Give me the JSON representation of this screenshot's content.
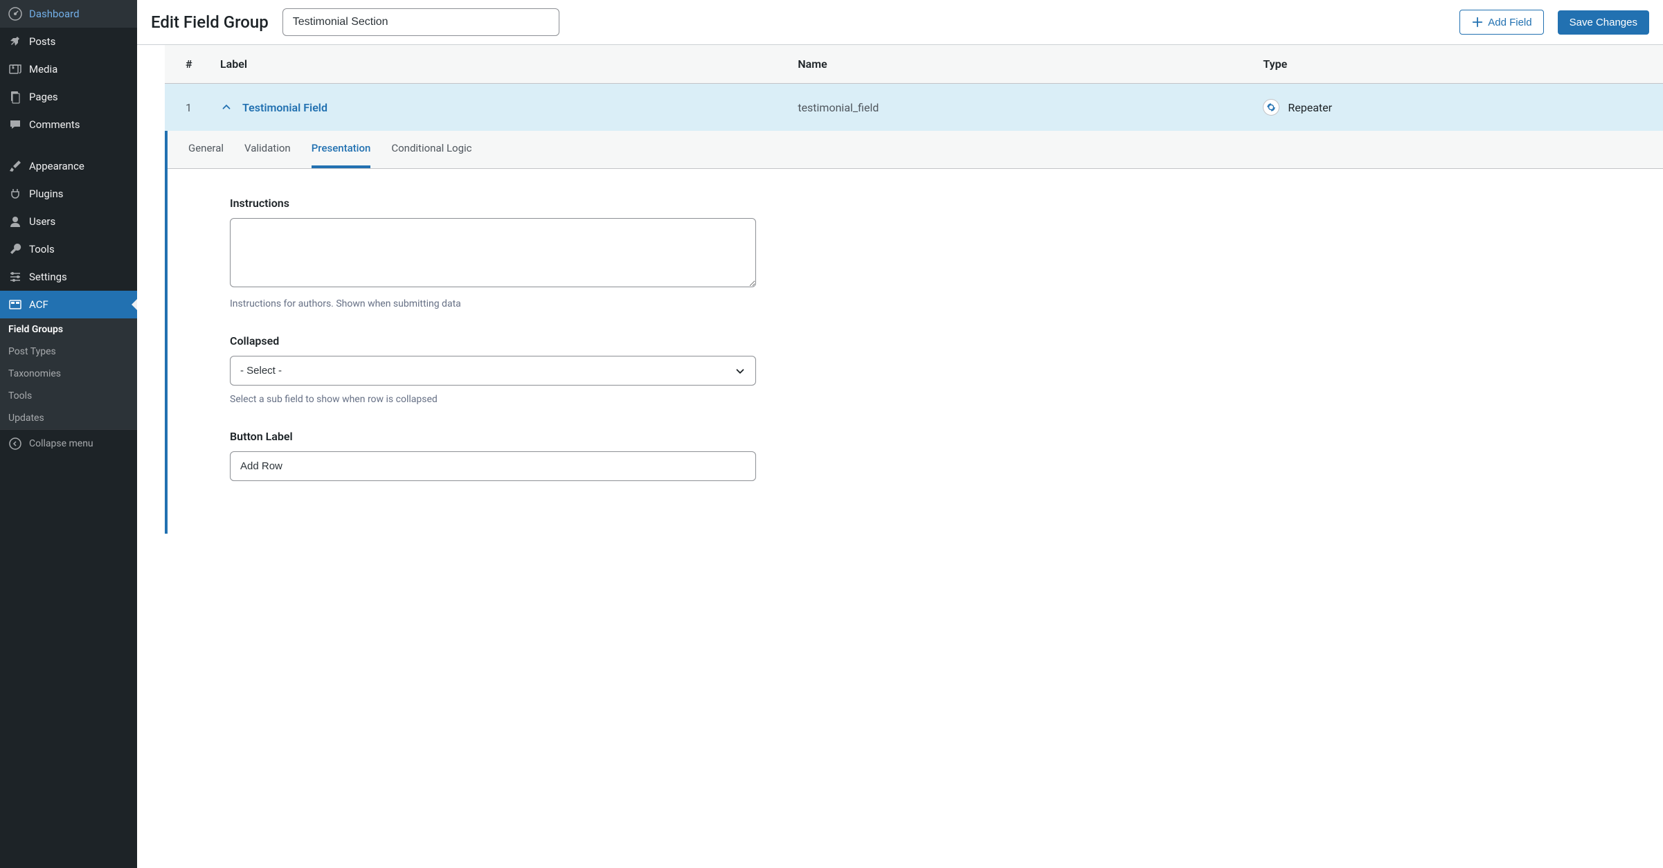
{
  "sidebar": {
    "items": [
      {
        "label": "Dashboard",
        "icon": "dashboard"
      },
      {
        "label": "Posts",
        "icon": "pin"
      },
      {
        "label": "Media",
        "icon": "media"
      },
      {
        "label": "Pages",
        "icon": "page"
      },
      {
        "label": "Comments",
        "icon": "comment"
      },
      {
        "label": "Appearance",
        "icon": "brush"
      },
      {
        "label": "Plugins",
        "icon": "plug"
      },
      {
        "label": "Users",
        "icon": "user"
      },
      {
        "label": "Tools",
        "icon": "wrench"
      },
      {
        "label": "Settings",
        "icon": "sliders"
      },
      {
        "label": "ACF",
        "icon": "acf",
        "active": true
      }
    ],
    "submenu": [
      {
        "label": "Field Groups",
        "active": true
      },
      {
        "label": "Post Types"
      },
      {
        "label": "Taxonomies"
      },
      {
        "label": "Tools"
      },
      {
        "label": "Updates"
      }
    ],
    "collapse_label": "Collapse menu"
  },
  "header": {
    "title": "Edit Field Group",
    "group_name": "Testimonial Section",
    "add_field_label": "Add Field",
    "save_label": "Save Changes"
  },
  "table": {
    "columns": {
      "num": "#",
      "label": "Label",
      "name": "Name",
      "type": "Type"
    },
    "rows": [
      {
        "num": "1",
        "label": "Testimonial Field",
        "name": "testimonial_field",
        "type": "Repeater"
      }
    ]
  },
  "tabs": [
    {
      "label": "General"
    },
    {
      "label": "Validation"
    },
    {
      "label": "Presentation",
      "active": true
    },
    {
      "label": "Conditional Logic"
    }
  ],
  "settings": {
    "instructions": {
      "label": "Instructions",
      "value": "",
      "help": "Instructions for authors. Shown when submitting data"
    },
    "collapsed": {
      "label": "Collapsed",
      "value": "- Select -",
      "help": "Select a sub field to show when row is collapsed"
    },
    "button_label": {
      "label": "Button Label",
      "value": "Add Row"
    }
  }
}
